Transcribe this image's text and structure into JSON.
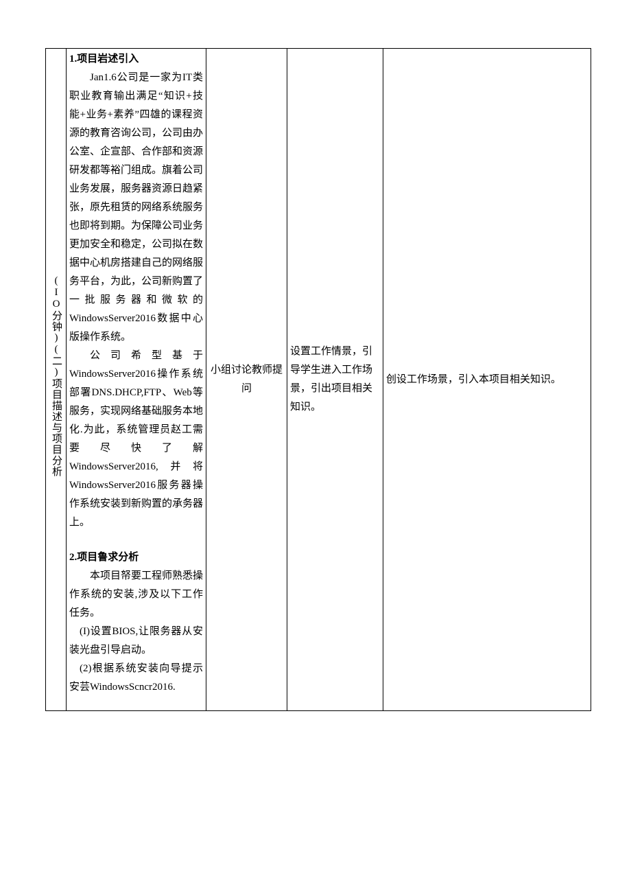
{
  "row": {
    "title": "(IO分钟)(二)项目描述与项目分析",
    "content": {
      "h1": "1.项目岩述引入",
      "p1": "Jan1.6公司是一家为IT类职业教育输出满足“知识+技能+业务+素养”四雄的课程资源的教育咨询公司，公司由办公室、企宣部、合作部和资源研发都等裕门组成。旗着公司业务发展，服务器资源日趋紧张，原先租赁的网络系统服务也即将到期。为保障公司业务更加安全和稳定，公司拟在数据中心机房搭建自己的网络服务平台，为此，公司新购置了一批服务器和微软的WindowsServer2016数据中心版操作系统。",
      "p2": "公司希型基于WindowsServer2016操作系统部署DNS.DHCP,FTP、Web等服务，实现网络基础服务本地化.为此，系统管理员赵工需要尽快了解WindowsServer2016,并将WindowsServer2016服务器操作系统安装到新购置的承务器上。",
      "h2": "2.项目鲁求分析",
      "p3": "本项目帑要工程师熟悉操作系统的安装,涉及以下工作任务。",
      "p4": "(I)设置BIOS,让限务器从安装光盘引导启动。",
      "p5": "(2)根据系统安装向导提示安芸WindowsScncr2016."
    },
    "method": "小组讨论教师提问",
    "activity": "设置工作情景，引导学生进入工作场景，引出项目相关知识。",
    "intent": "创设工作场景，引入本项目相关知识。"
  }
}
